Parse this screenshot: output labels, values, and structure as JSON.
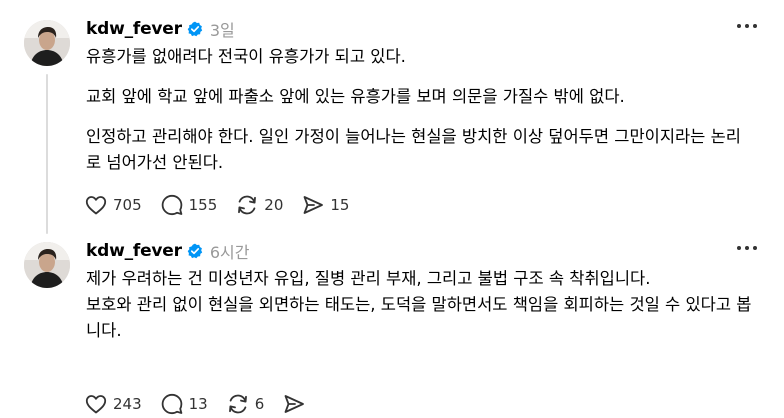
{
  "posts": [
    {
      "username": "kdw_fever",
      "timestamp": "3일",
      "paragraphs": [
        "유흥가를 없애려다 전국이 유흥가가 되고 있다.",
        "교회 앞에 학교 앞에 파출소 앞에 있는 유흥가를 보며 의문을 가질수 밖에 없다.",
        "인정하고 관리해야 한다. 일인 가정이 늘어나는 현실을 방치한 이상 덮어두면 그만이지라는 논리로 넘어가선 안된다."
      ],
      "likes": "705",
      "replies": "155",
      "reposts": "20",
      "shares": "15"
    },
    {
      "username": "kdw_fever",
      "timestamp": "6시간",
      "paragraphs": [
        "제가 우려하는 건 미성년자 유입, 질병 관리 부재, 그리고 불법 구조 속 착취입니다.",
        "보호와 관리 없이 현실을 외면하는 태도는, 도덕을 말하면서도 책임을 회피하는 것일 수 있다고 봅니다."
      ],
      "likes": "243",
      "replies": "13",
      "reposts": "6",
      "shares": ""
    }
  ],
  "colors": {
    "verified_badge": "#0095f6",
    "timestamp": "#999999",
    "icon": "#333333",
    "thread_line": "#dcdcdc"
  },
  "icons": [
    "heart-icon",
    "comment-icon",
    "repost-icon",
    "share-icon",
    "more-icon",
    "verified-badge-icon"
  ]
}
